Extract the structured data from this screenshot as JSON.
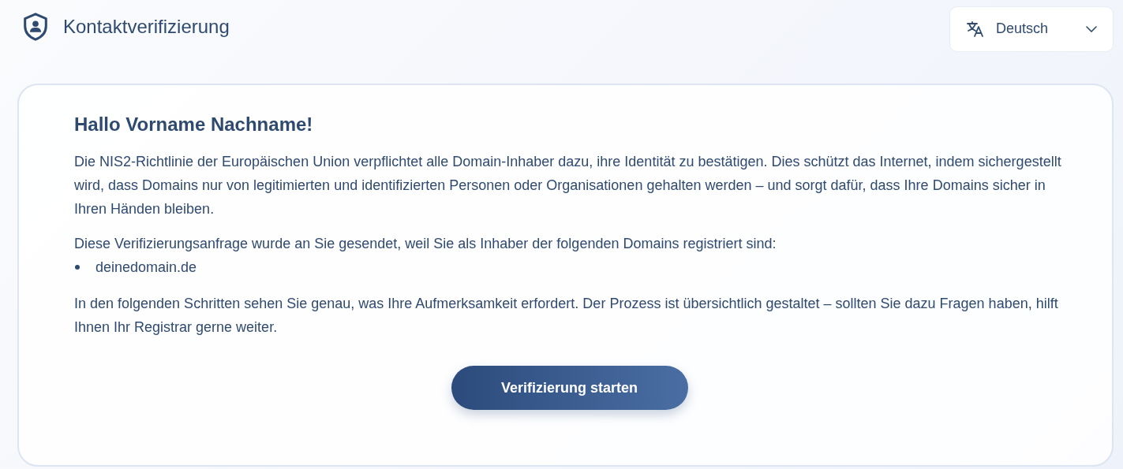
{
  "header": {
    "title": "Kontaktverifizierung",
    "language": {
      "label": "Deutsch"
    }
  },
  "card": {
    "greeting": "Hallo Vorname Nachname!",
    "paragraphs": [
      "Die NIS2-Richtlinie der Europäischen Union verpflichtet alle Domain-Inhaber dazu, ihre Identität zu bestätigen. Dies schützt das Internet, indem sichergestellt wird, dass Domains nur von legitimierten und identifizierten Personen oder Organisationen gehalten werden – und sorgt dafür, dass Ihre Domains sicher in Ihren Händen bleiben.",
      "Diese Verifizierungsanfrage wurde an Sie gesendet, weil Sie als Inhaber der folgenden Domains registriert sind:"
    ],
    "domains": [
      "deinedomain.de"
    ],
    "closing": "In den folgenden Schritten sehen Sie genau, was Ihre Aufmerksamkeit erfordert. Der Prozess ist übersichtlich gestaltet – sollten Sie dazu Fragen haben, hilft Ihnen Ihr Registrar gerne weiter.",
    "button": "Verifizierung starten"
  }
}
